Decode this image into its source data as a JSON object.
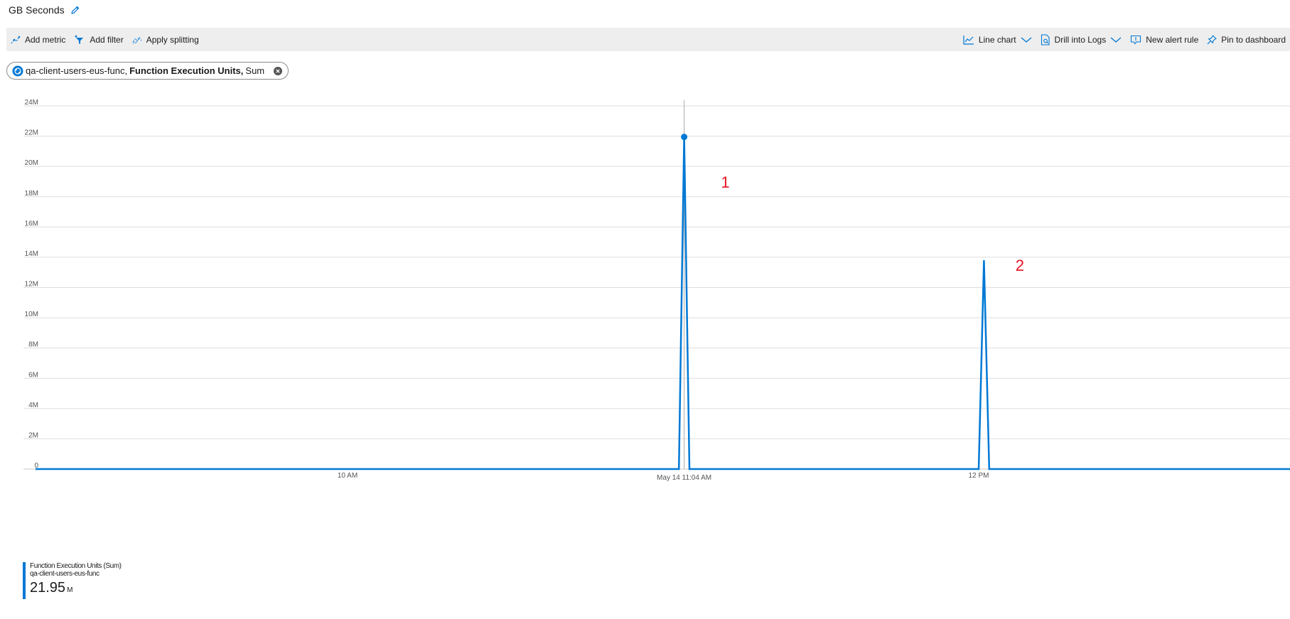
{
  "header": {
    "title": "GB Seconds",
    "edit_icon": "pencil-icon"
  },
  "toolbar": {
    "add_metric": "Add metric",
    "add_filter": "Add filter",
    "apply_splitting": "Apply splitting",
    "line_chart": "Line chart",
    "drill_into_logs": "Drill into Logs",
    "new_alert_rule": "New alert rule",
    "pin_to_dashboard": "Pin to dashboard",
    "accent_color": "#0078d4"
  },
  "metric_pill": {
    "resource": "qa-client-users-eus-func,",
    "metric": "Function Execution Units,",
    "aggregation": "Sum"
  },
  "chart_data": {
    "type": "line",
    "title": "",
    "xlabel": "",
    "ylabel": "",
    "y_ticks": [
      "0",
      "2M",
      "4M",
      "6M",
      "8M",
      "10M",
      "12M",
      "14M",
      "16M",
      "18M",
      "20M",
      "22M",
      "24M"
    ],
    "ylim": [
      0,
      24000000
    ],
    "x_ticks": [
      {
        "label": "10 AM",
        "time": "10:00"
      },
      {
        "label": "May 14 11:04 AM",
        "time": "11:04"
      },
      {
        "label": "12 PM",
        "time": "12:00"
      }
    ],
    "grid": true,
    "series": [
      {
        "name": "Function Execution Units (Sum)",
        "color": "#0078d4",
        "x": [
          "09:00",
          "11:03",
          "11:04",
          "11:05",
          "12:00",
          "12:01",
          "12:02",
          "13:00"
        ],
        "values": [
          0,
          0,
          21950000,
          0,
          0,
          13800000,
          0,
          0
        ]
      }
    ],
    "cursor": {
      "time": "11:04",
      "value": 21950000
    },
    "annotations": [
      {
        "text": "1",
        "time": "11:11",
        "value": 18600000
      },
      {
        "text": "2",
        "time": "12:07",
        "value": 13100000
      }
    ]
  },
  "legend": {
    "metric": "Function Execution Units (Sum)",
    "resource": "qa-client-users-eus-func",
    "value": "21.95",
    "unit": "M"
  }
}
